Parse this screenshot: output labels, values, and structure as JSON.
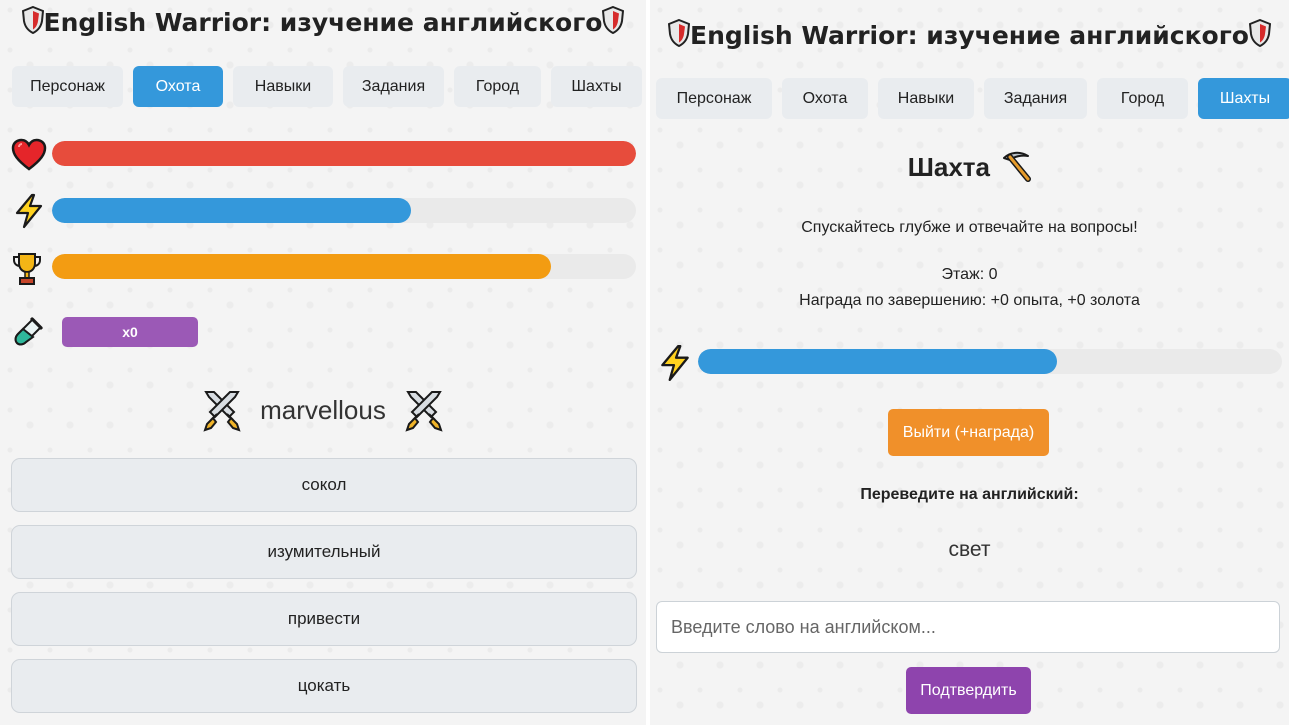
{
  "app": {
    "title": "English Warrior: изучение английского",
    "accent_color": "#3498db"
  },
  "left_screen": {
    "tabs": [
      {
        "label": "Персонаж",
        "active": false
      },
      {
        "label": "Охота",
        "active": true
      },
      {
        "label": "Навыки",
        "active": false
      },
      {
        "label": "Задания",
        "active": false
      },
      {
        "label": "Город",
        "active": false
      },
      {
        "label": "Шахты",
        "active": false
      }
    ],
    "stats": [
      {
        "icon": "heart-icon",
        "fraction": 1.0,
        "color": "#e74c3c"
      },
      {
        "icon": "lightning-icon",
        "fraction": 0.615,
        "color": "#3498db"
      },
      {
        "icon": "trophy-icon",
        "fraction": 0.855,
        "color": "#f39c12"
      }
    ],
    "potion": {
      "icon": "potion-icon",
      "count_label": "x0",
      "color": "#9b59b6"
    },
    "current_word": "marvellous",
    "answers": [
      "сокол",
      "изумительный",
      "привести",
      "цокать"
    ]
  },
  "right_screen": {
    "tabs": [
      {
        "label": "Персонаж",
        "active": false
      },
      {
        "label": "Охота",
        "active": false
      },
      {
        "label": "Навыки",
        "active": false
      },
      {
        "label": "Задания",
        "active": false
      },
      {
        "label": "Город",
        "active": false
      },
      {
        "label": "Шахты",
        "active": true
      }
    ],
    "mine": {
      "title": "Шахта",
      "subtitle": "Спускайтесь глубже и отвечайте на вопросы!",
      "floor": "Этаж: 0",
      "reward": "Награда по завершению: +0 опыта, +0 золота",
      "energy": {
        "icon": "lightning-icon",
        "fraction": 0.615,
        "color": "#3498db"
      },
      "exit_label": "Выйти (+награда)",
      "exit_color": "#f0902a",
      "prompt": "Переведите на английский:",
      "word": "свет",
      "input_value": "",
      "input_placeholder": "Введите слово на английском...",
      "confirm_label": "Подтвердить",
      "confirm_color": "#8e44ad"
    }
  }
}
